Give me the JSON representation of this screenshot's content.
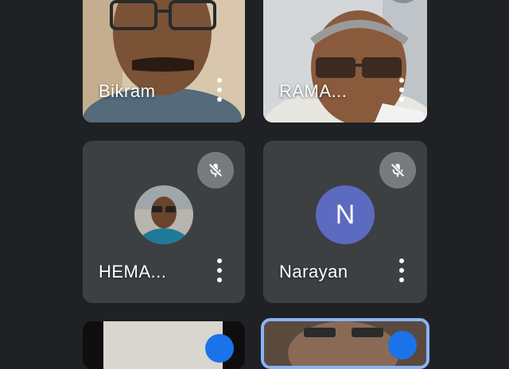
{
  "tiles": [
    {
      "name": "Bikram"
    },
    {
      "name": "RAMA..."
    },
    {
      "name": "HEMA..."
    },
    {
      "name": "Narayan",
      "avatar_letter": "N"
    },
    {
      "name": ""
    },
    {
      "name": ""
    }
  ],
  "icons": {
    "more": "more-vert-icon",
    "mute": "mic-off-icon"
  },
  "colors": {
    "background": "#202124",
    "tile": "#3c4043",
    "avatar": "#5c6bc0",
    "active_border": "#8ab4f8"
  }
}
